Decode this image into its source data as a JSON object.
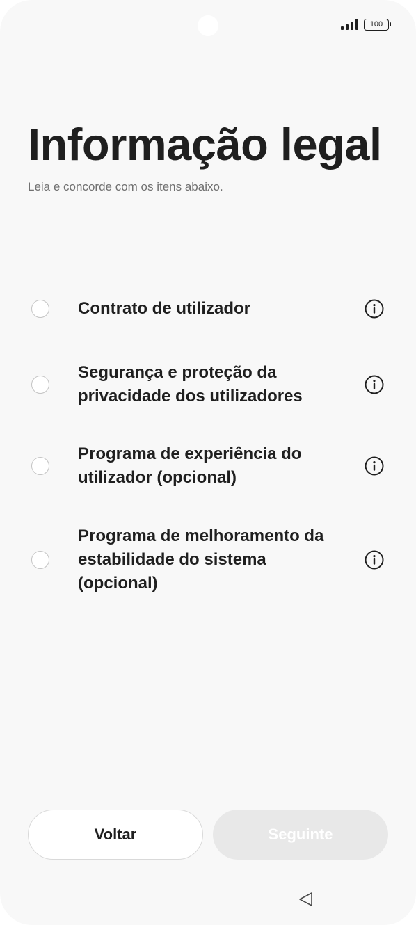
{
  "status_bar": {
    "battery_level": "100",
    "signal_bars": 4
  },
  "header": {
    "title": "Informação legal",
    "subtitle": "Leia e concorde com os itens abaixo."
  },
  "items": [
    {
      "label": "Contrato de utilizador",
      "checked": false,
      "icon": "info-icon"
    },
    {
      "label": "Segurança e proteção da privacidade dos utilizadores",
      "checked": false,
      "icon": "info-icon"
    },
    {
      "label": "Programa de experiência do utilizador (opcional)",
      "checked": false,
      "icon": "info-icon"
    },
    {
      "label": "Programa de melhoramento da estabilidade do sistema (opcional)",
      "checked": false,
      "icon": "info-icon"
    }
  ],
  "buttons": {
    "back_label": "Voltar",
    "next_label": "Seguinte",
    "next_enabled": false
  },
  "colors": {
    "background": "#f8f8f8",
    "text_primary": "#1f1f1f",
    "text_secondary": "#707070",
    "disabled_button": "#e8e8e8"
  }
}
